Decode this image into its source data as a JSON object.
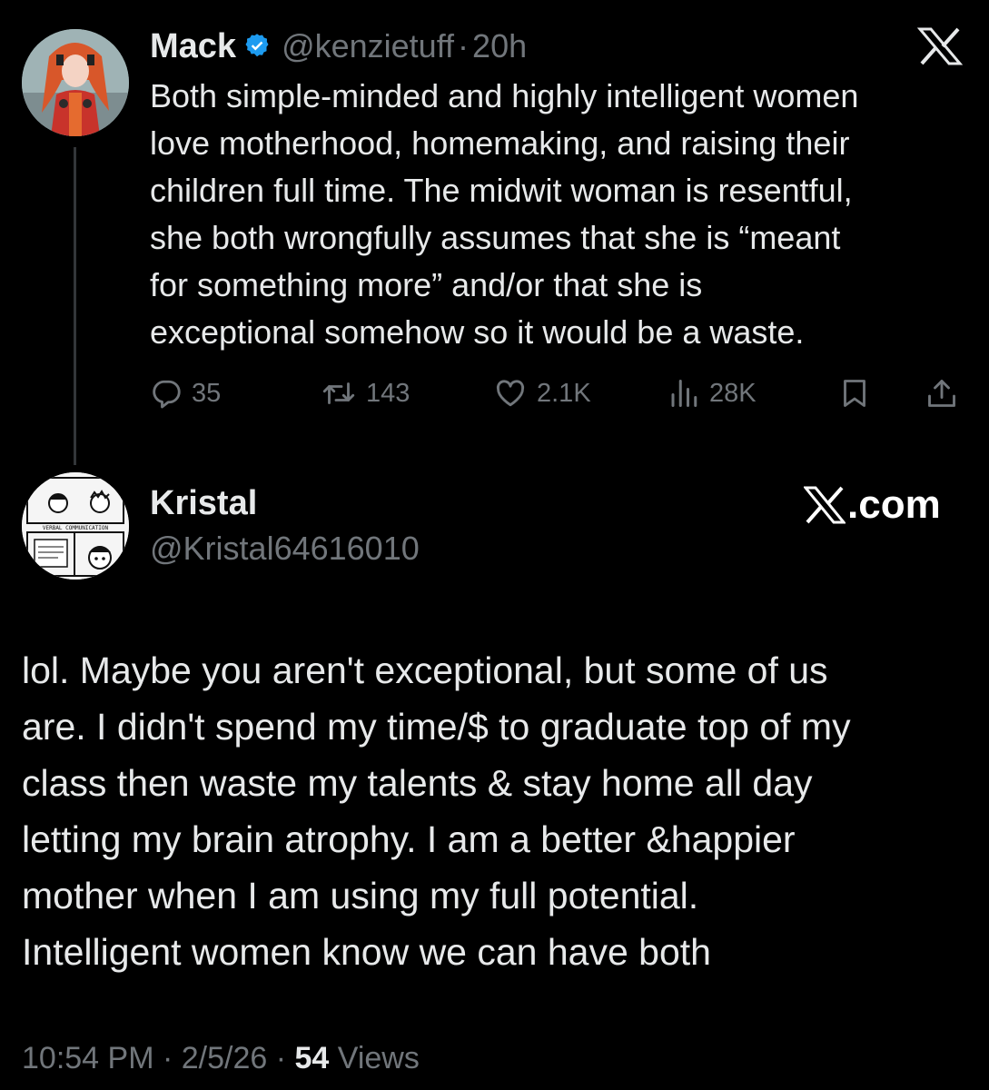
{
  "tweet": {
    "author_name": "Mack",
    "handle": "@kenzietuff",
    "separator": "·",
    "time_ago": "20h",
    "body": "Both simple-minded and highly intelligent women\nlove motherhood, homemaking, and raising their\nchildren full time. The midwit woman is resentful,\nshe both wrongfully assumes that she is “meant\nfor something more” and/or that she is\nexceptional somehow so it would be a waste.",
    "verified_color": "#1d9bf0",
    "icons": {
      "platform": "x-logo-icon",
      "verified": "verified-badge-icon",
      "avatar": "anime-cosplay-avatar"
    },
    "actions": [
      {
        "name": "reply",
        "icon": "reply-icon",
        "count": "35"
      },
      {
        "name": "repost",
        "icon": "repost-icon",
        "count": "143"
      },
      {
        "name": "like",
        "icon": "heart-icon",
        "count": "2.1K"
      },
      {
        "name": "views",
        "icon": "bar-chart-icon",
        "count": "28K"
      },
      {
        "name": "bookmark",
        "icon": "bookmark-icon",
        "count": ""
      },
      {
        "name": "share",
        "icon": "share-icon",
        "count": ""
      }
    ]
  },
  "reply": {
    "author_name": "Kristal",
    "handle": "@Kristal64616010",
    "brand": ".com",
    "body": "lol. Maybe you aren't exceptional, but some of us\nare. I didn't spend my time/$ to graduate top of my\nclass then waste my talents & stay home all day\nletting my brain atrophy. I am a better &happier\nmother when I am using my full potential.\nIntelligent women know we can have both",
    "avatar_caption": "VERBAL COMMUNICATION",
    "icons": {
      "brand": "x-logo-icon",
      "avatar": "comic-strip-avatar"
    },
    "footer": {
      "time": "10:54 PM",
      "sep1": " · ",
      "date": "2/5/26",
      "sep2": " · ",
      "views_count": "54",
      "views_label": " Views"
    }
  },
  "colors": {
    "background": "#000000",
    "text_primary": "#e7e9ea",
    "text_secondary": "#71767b",
    "accent": "#1d9bf0"
  }
}
